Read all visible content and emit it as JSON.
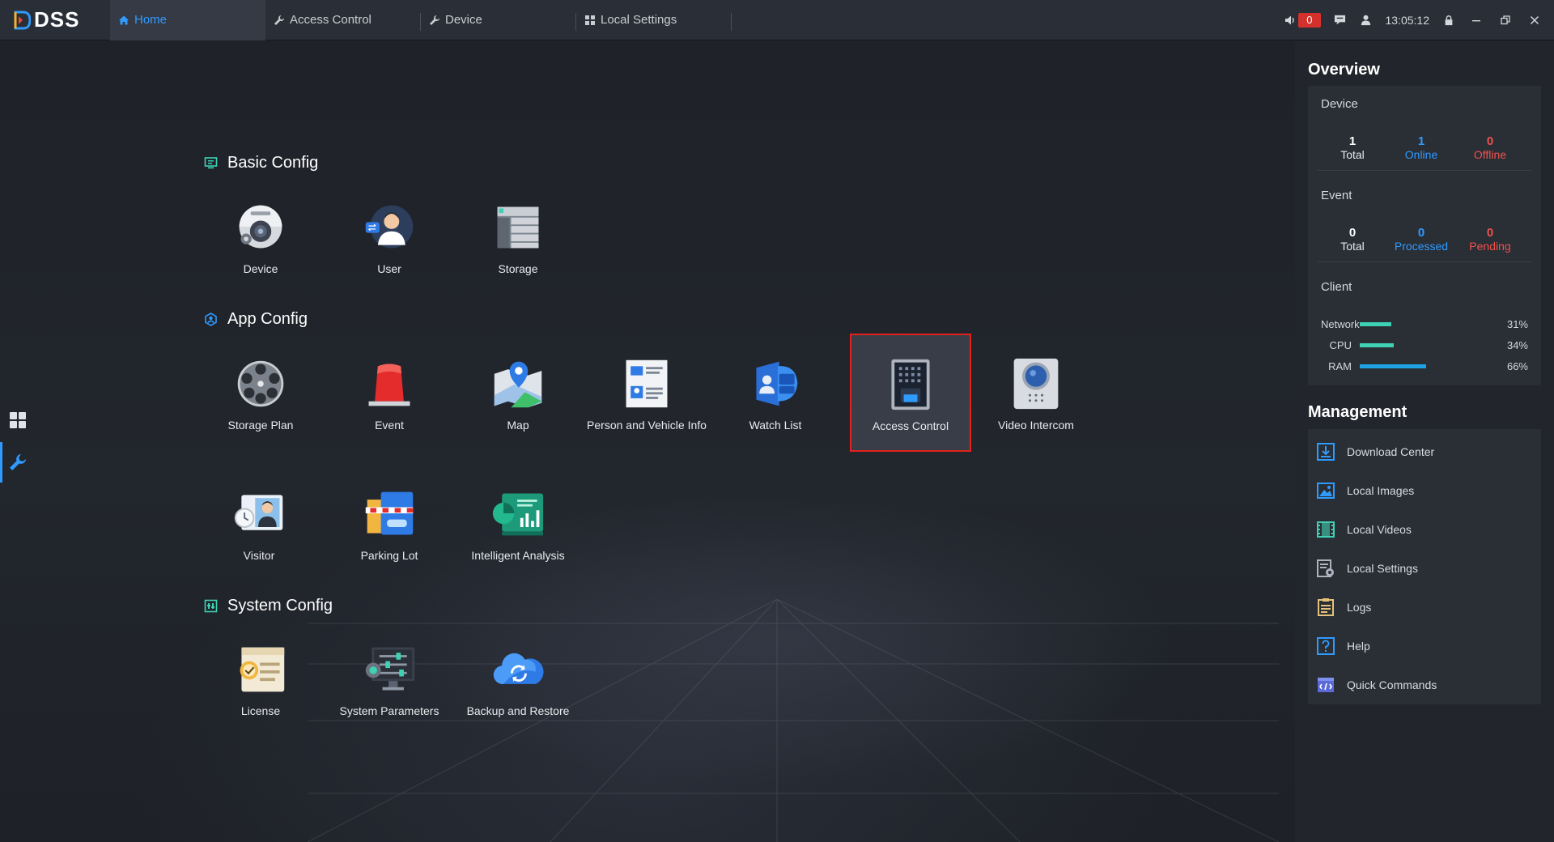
{
  "app": {
    "logo_text": "DSS",
    "brand_color": "#2f9bff"
  },
  "tabs": [
    {
      "label": "Home",
      "icon": "home-icon",
      "active": true
    },
    {
      "label": "Access Control",
      "icon": "wrench-icon",
      "active": false
    },
    {
      "label": "Device",
      "icon": "wrench-icon",
      "active": false
    },
    {
      "label": "Local Settings",
      "icon": "grid-icon",
      "active": false
    }
  ],
  "titlebar": {
    "alarm_count": "0",
    "time": "13:05:12"
  },
  "rail": [
    {
      "icon": "apps-grid-icon",
      "active": false
    },
    {
      "icon": "wrench-icon",
      "active": true
    }
  ],
  "sections": {
    "basic": {
      "title": "Basic Config",
      "items": [
        "Device",
        "User",
        "Storage"
      ]
    },
    "app": {
      "title": "App Config",
      "items": [
        "Storage Plan",
        "Event",
        "Map",
        "Person and Vehicle Info",
        "Watch List",
        "Access Control",
        "Video Intercom",
        "Visitor",
        "Parking Lot",
        "Intelligent Analysis"
      ],
      "highlighted": "Access Control"
    },
    "system": {
      "title": "System Config",
      "items": [
        "License",
        "System Parameters",
        "Backup and Restore"
      ]
    }
  },
  "overview": {
    "title": "Overview",
    "device": {
      "title": "Device",
      "total": "1",
      "total_label": "Total",
      "online": "1",
      "online_label": "Online",
      "offline": "0",
      "offline_label": "Offline"
    },
    "event": {
      "title": "Event",
      "total": "0",
      "total_label": "Total",
      "processed": "0",
      "processed_label": "Processed",
      "pending": "0",
      "pending_label": "Pending"
    },
    "client": {
      "title": "Client",
      "metrics": [
        {
          "label": "Network",
          "value": "31%",
          "fraction": 0.31,
          "color": "#3fd1b4"
        },
        {
          "label": "CPU",
          "value": "34%",
          "fraction": 0.34,
          "color": "#3fd1b4"
        },
        {
          "label": "RAM",
          "value": "66%",
          "fraction": 0.66,
          "color": "#1fa3e6"
        }
      ]
    }
  },
  "management": {
    "title": "Management",
    "items": [
      {
        "label": "Download Center",
        "icon": "download-icon"
      },
      {
        "label": "Local Images",
        "icon": "image-icon"
      },
      {
        "label": "Local Videos",
        "icon": "film-icon"
      },
      {
        "label": "Local Settings",
        "icon": "settings-doc-icon"
      },
      {
        "label": "Logs",
        "icon": "log-icon"
      },
      {
        "label": "Help",
        "icon": "help-icon"
      },
      {
        "label": "Quick Commands",
        "icon": "command-icon"
      }
    ]
  },
  "colors": {
    "online": "#2f9bff",
    "offline": "#f0524d",
    "highlight_border": "#e3221d"
  }
}
